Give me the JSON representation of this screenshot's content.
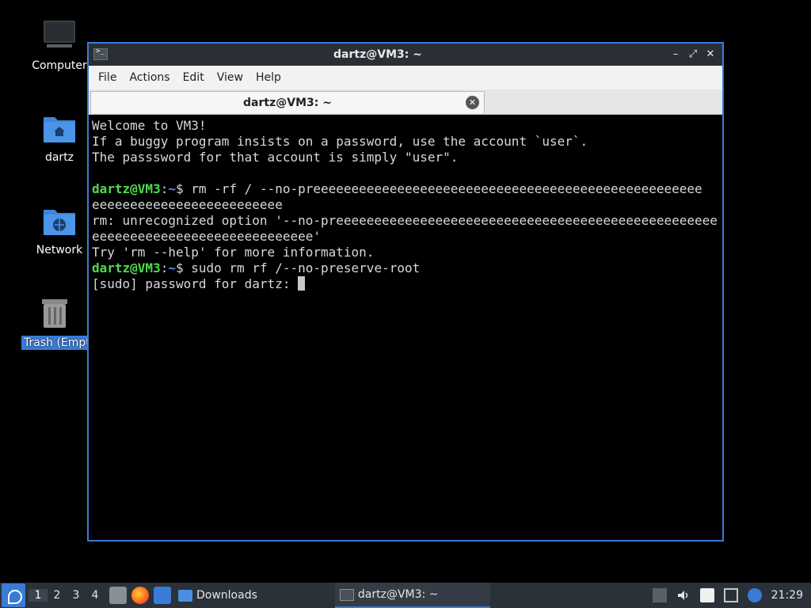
{
  "desktop": {
    "icons": [
      {
        "label": "Computer"
      },
      {
        "label": "dartz"
      },
      {
        "label": "Network"
      },
      {
        "label": "Trash (Empt"
      }
    ]
  },
  "window": {
    "title": "dartz@VM3: ~",
    "controls": {
      "minimize": "–",
      "maximize": "⤢",
      "close": "✕"
    },
    "menu": [
      "File",
      "Actions",
      "Edit",
      "View",
      "Help"
    ],
    "tab": {
      "label": "dartz@VM3: ~",
      "close": "✕"
    }
  },
  "terminal": {
    "lines": [
      {
        "text": "Welcome to VM3!"
      },
      {
        "text": "If a buggy program insists on a password, use the account `user`."
      },
      {
        "text": "The passsword for that account is simply \"user\"."
      },
      {
        "text": ""
      },
      {
        "user": "dartz@VM3",
        "sep": ":",
        "path": "~",
        "text": "$ rm -rf / --no-preeeeeeeeeeeeeeeeeeeeeeeeeeeeeeeeeeeeeeeeeeeeeeeeeee"
      },
      {
        "text": "eeeeeeeeeeeeeeeeeeeeeeeee"
      },
      {
        "text": "rm: unrecognized option '--no-preeeeeeeeeeeeeeeeeeeeeeeeeeeeeeeeeeeeeeeeeeeeeeeeee"
      },
      {
        "text": "eeeeeeeeeeeeeeeeeeeeeeeeeeeee'"
      },
      {
        "text": "Try 'rm --help' for more information."
      },
      {
        "user": "dartz@VM3",
        "sep": ":",
        "path": "~",
        "text": "$ sudo rm rf /--no-preserve-root"
      },
      {
        "text": "[sudo] password for dartz: "
      }
    ]
  },
  "taskbar": {
    "workspaces": [
      "1",
      "2",
      "3",
      "4"
    ],
    "active_workspace": "1",
    "tasks": [
      {
        "label": "Downloads",
        "icon": "folder-icon"
      },
      {
        "label": "dartz@VM3: ~",
        "icon": "terminal-icon"
      }
    ],
    "clock": "21:29"
  }
}
